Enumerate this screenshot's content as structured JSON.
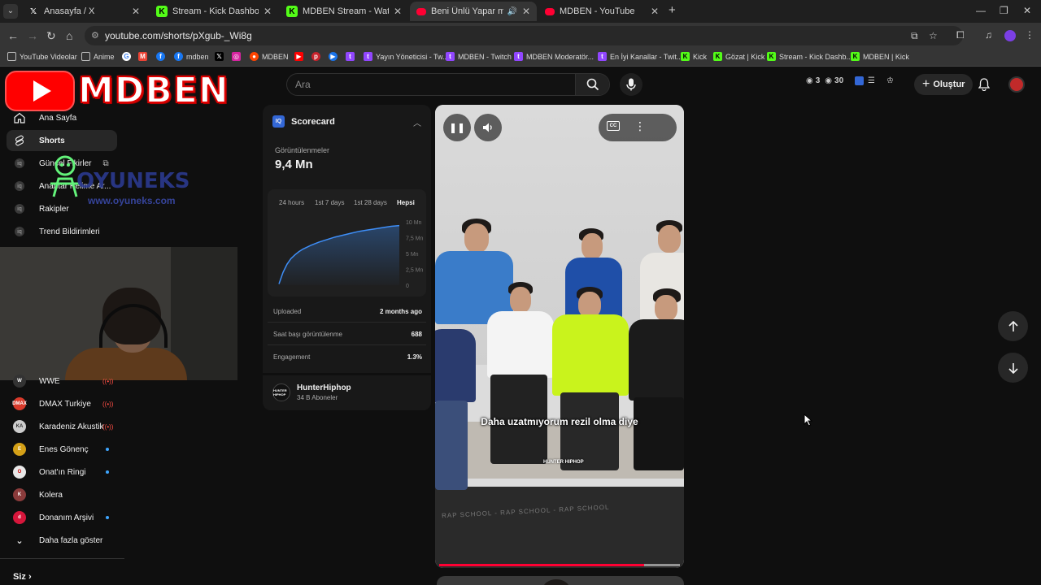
{
  "browser": {
    "tabs": [
      {
        "title": "Anasayfa / X",
        "icon": "X"
      },
      {
        "title": "Stream - Kick Dashboard",
        "icon": "K"
      },
      {
        "title": "MDBEN Stream - Watch Live on",
        "icon": "K"
      },
      {
        "title": "Beni Ünlü Yapar mısın İbrahi",
        "icon": "yt"
      },
      {
        "title": "MDBEN - YouTube",
        "icon": "yt"
      }
    ],
    "url": "youtube.com/shorts/pXgub-_Wi8g",
    "bookmarks": [
      {
        "label": "YouTube Videolar",
        "color": "#444444",
        "glyph": "▢"
      },
      {
        "label": "Anime",
        "color": "#444444",
        "glyph": "▢"
      },
      {
        "label": "mdben",
        "color": "#1877f2",
        "glyph": "f"
      },
      {
        "label": "MDBEN",
        "color": "#e0442a",
        "glyph": "●"
      },
      {
        "label": "Yayın Yöneticisi - Tw...",
        "color": "#9146ff",
        "glyph": "t"
      },
      {
        "label": "MDBEN - Twitch",
        "color": "#9146ff",
        "glyph": "t"
      },
      {
        "label": "MDBEN Moderatör...",
        "color": "#9146ff",
        "glyph": "t"
      },
      {
        "label": "En İyi Kanallar - Twit...",
        "color": "#9146ff",
        "glyph": "t"
      },
      {
        "label": "Kick",
        "color": "#53fc18",
        "glyph": "K"
      },
      {
        "label": "Gözat | Kick",
        "color": "#53fc18",
        "glyph": "K"
      },
      {
        "label": "Stream - Kick Dashb...",
        "color": "#53fc18",
        "glyph": "K"
      },
      {
        "label": "MDBEN | Kick",
        "color": "#53fc18",
        "glyph": "K"
      }
    ]
  },
  "header": {
    "channel_logo_text": "MDBEN",
    "search_placeholder": "Ara",
    "stat_views_1": "3",
    "stat_views_2": "30",
    "create_label": "Oluştur"
  },
  "sidebar": {
    "items": [
      {
        "label": "Ana Sayfa"
      },
      {
        "label": "Shorts"
      },
      {
        "label": "Güncel Fikirler"
      },
      {
        "label": "Anahtar Kelime Ar..."
      },
      {
        "label": "Rakipler"
      },
      {
        "label": "Trend Bildirimleri"
      }
    ],
    "overlay": {
      "name": "OYUNEKS",
      "url": "www.oyuneks.com"
    },
    "subscriptions": [
      {
        "label": "WWE",
        "badge": "live",
        "color": "#333333",
        "initials": "W"
      },
      {
        "label": "DMAX Turkiye",
        "badge": "live",
        "color": "#d93a2b",
        "initials": "DMAX"
      },
      {
        "label": "Karadeniz Akustik",
        "badge": "live",
        "color": "#cccccc",
        "initials": "KA"
      },
      {
        "label": "Enes Gönenç",
        "badge": "dot",
        "color": "#d4a017",
        "initials": "E"
      },
      {
        "label": "Onat'ın Ringi",
        "badge": "dot",
        "color": "#e8e8e8",
        "initials": "O"
      },
      {
        "label": "Kolera",
        "badge": "",
        "color": "#8a3b3b",
        "initials": "K"
      },
      {
        "label": "Donanım Arşivi",
        "badge": "dot",
        "color": "#d6163b",
        "initials": "d"
      },
      {
        "label": "Daha fazla göster",
        "badge": "",
        "color": "",
        "initials": ""
      }
    ],
    "you_label": "Siz"
  },
  "scorecard": {
    "title": "Scorecard",
    "views_label": "Görüntülenmeler",
    "views_value": "9,4 Mn",
    "tabs": [
      "24 hours",
      "1st 7 days",
      "1st 28 days",
      "Hepsi"
    ],
    "active_tab": "Hepsi",
    "uploaded_label": "Uploaded",
    "uploaded_value": "2 months ago",
    "hourly_label": "Saat başı görüntülenme",
    "hourly_value": "688",
    "engagement_label": "Engagement",
    "engagement_value": "1.3%",
    "channel_name": "HunterHiphop",
    "channel_subs": "34 B Aboneler",
    "channel_avatar_text": "HUNTER HIPHOP"
  },
  "chart_data": {
    "type": "area",
    "title": "",
    "xlabel": "",
    "ylabel": "",
    "y_ticks": [
      "10 Mn",
      "7,5 Mn",
      "5 Mn",
      "2,5 Mn",
      "0"
    ],
    "ylim": [
      0,
      10
    ],
    "x": [
      0,
      1,
      2,
      3,
      4,
      5,
      6,
      8,
      10,
      12,
      14,
      16,
      18,
      20,
      22,
      24,
      26,
      28,
      30
    ],
    "values": [
      0.2,
      2.0,
      3.3,
      4.2,
      4.8,
      5.3,
      5.7,
      6.3,
      6.8,
      7.2,
      7.6,
      7.9,
      8.2,
      8.5,
      8.7,
      8.9,
      9.1,
      9.3,
      9.4
    ],
    "color": "#3e8ef7"
  },
  "video": {
    "caption": "Daha uzatmıyorum rezil olma diye",
    "watermark": "HUNTER HIPHOP",
    "floor_text": "RAP SCHOOL - RAP SCHOOL - RAP SCHOOL",
    "progress": 0.85
  }
}
